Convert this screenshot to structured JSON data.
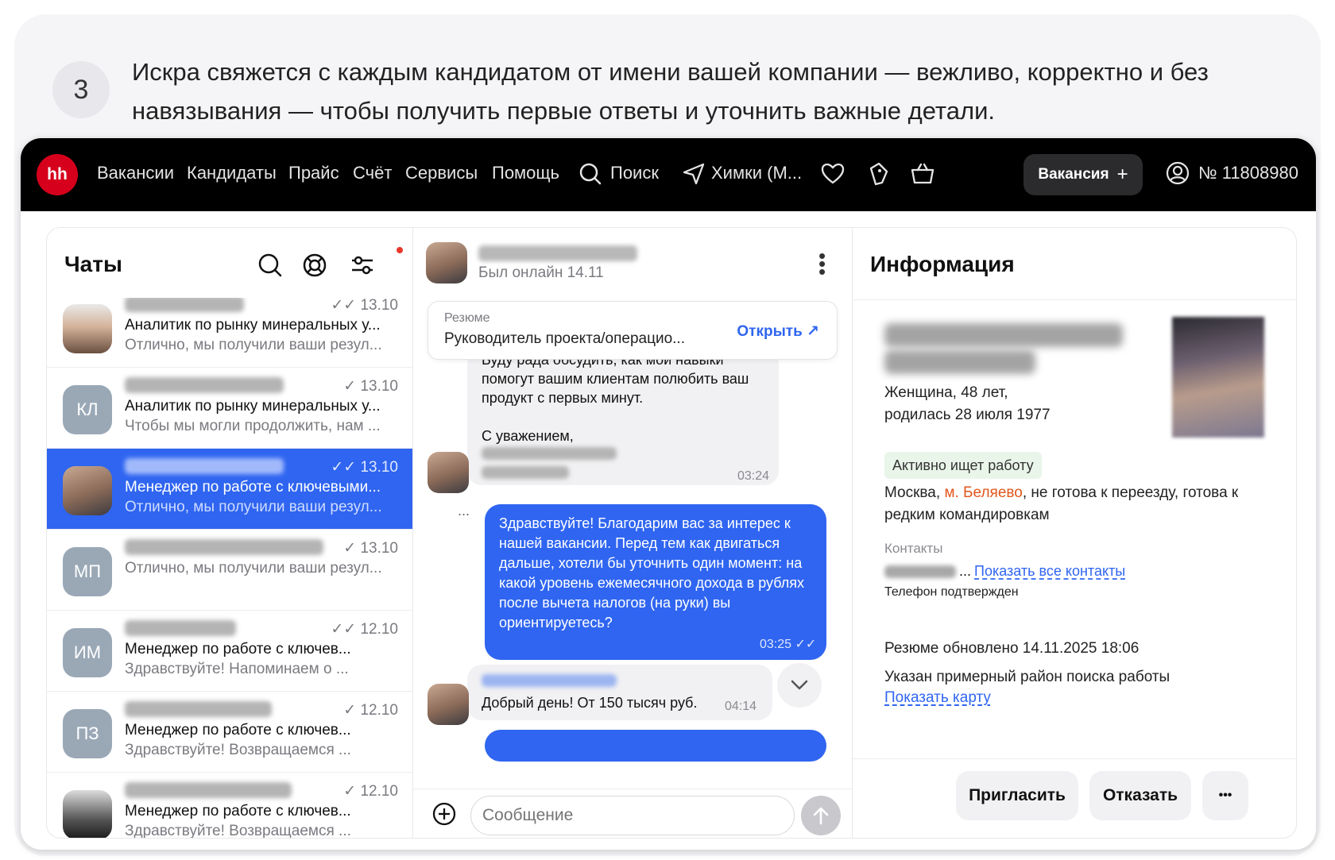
{
  "step": {
    "number": "3",
    "text_line1": "Искра свяжется с каждым кандидатом от имени вашей компании — вежливо, корректно и без",
    "text_line2": "навязывания — чтобы получить первые ответы и уточнить важные детали."
  },
  "topbar": {
    "logo": "hh",
    "nav": [
      "Вакансии",
      "Кандидаты",
      "Прайс",
      "Счёт",
      "Сервисы",
      "Помощь"
    ],
    "search_label": "Поиск",
    "location_label": "Химки (М...",
    "vacancy_button": "Вакансия",
    "account_number": "№ 11808980",
    "accent_color": "#d6001c"
  },
  "chats": {
    "title": "Чаты",
    "items": [
      {
        "avatar": "",
        "date": "13.10",
        "line1": "Аналитик по рынку минеральных у...",
        "line2": "Отлично, мы получили ваши резул...",
        "read": "double-check"
      },
      {
        "avatar": "КЛ",
        "date": "13.10",
        "line1": "Аналитик по рынку минеральных у...",
        "line2": "Чтобы мы могли продолжить, нам ...",
        "read": "check"
      },
      {
        "avatar": "",
        "date": "13.10",
        "line1": "Менеджер по работе с ключевыми...",
        "line2": "Отлично, мы получили ваши резул...",
        "read": "double-check",
        "active": true
      },
      {
        "avatar": "МП",
        "date": "13.10",
        "line1": "",
        "line2": "Отлично, мы получили ваши резул...",
        "read": "check"
      },
      {
        "avatar": "ИМ",
        "date": "12.10",
        "line1": "Менеджер по работе с ключев...",
        "line2": "Здравствуйте! Напоминаем о ...",
        "read": "double-check"
      },
      {
        "avatar": "ПЗ",
        "date": "12.10",
        "line1": "Менеджер по работе с ключев...",
        "line2": "Здравствуйте! Возвращаемся ...",
        "read": "check"
      },
      {
        "avatar": "",
        "date": "12.10",
        "line1": "Менеджер по работе с ключев...",
        "line2": "Здравствуйте! Возвращаемся ...",
        "read": "check"
      }
    ]
  },
  "conversation": {
    "status": "Был онлайн 14.11",
    "resume": {
      "label": "Резюме",
      "title": "Руководитель проекта/операцио...",
      "open_label": "Открыть"
    },
    "incoming_1": {
      "lines": [
        "Буду рада обсудить, как мои навыки",
        "помогут вашим клиентам полюбить ваш",
        "продукт с первых минут.",
        "С уважением,"
      ],
      "time": "03:24"
    },
    "typing": "...",
    "outgoing": {
      "text": "Здравствуйте! Благодарим вас за интерес к нашей вакансии. Перед тем как двигаться дальше, хотели бы уточнить один момент: на какой уровень ежемесячного дохода в рублях после вычета налогов (на руки) вы ориентируетесь?",
      "time": "03:25"
    },
    "incoming_2": {
      "text": "Добрый день! От 150 тысяч руб.",
      "time": "04:14"
    },
    "input_placeholder": "Сообщение"
  },
  "info": {
    "title": "Информация",
    "demographics_line1": "Женщина, 48 лет,",
    "demographics_line2": "родилась 28 июля 1977",
    "status_tag": "Активно ищет работу",
    "location_prefix": "Москва, ",
    "metro": "м. Беляево",
    "location_suffix": ", не готова к переезду, готова к",
    "location_line2": "редким командировкам",
    "contacts_label": "Контакты",
    "phone_ellipsis": "...",
    "show_contacts": "Показать все контакты",
    "phone_verified": "Телефон подтвержден",
    "resume_updated": "Резюме обновлено 14.11.2025 18:06",
    "search_area": "Указан примерный район поиска работы",
    "show_map": "Показать карту",
    "invite_button": "Пригласить",
    "reject_button": "Отказать",
    "more_button": "•••",
    "link_color": "#2f65f0",
    "metro_color": "#e2561c"
  }
}
